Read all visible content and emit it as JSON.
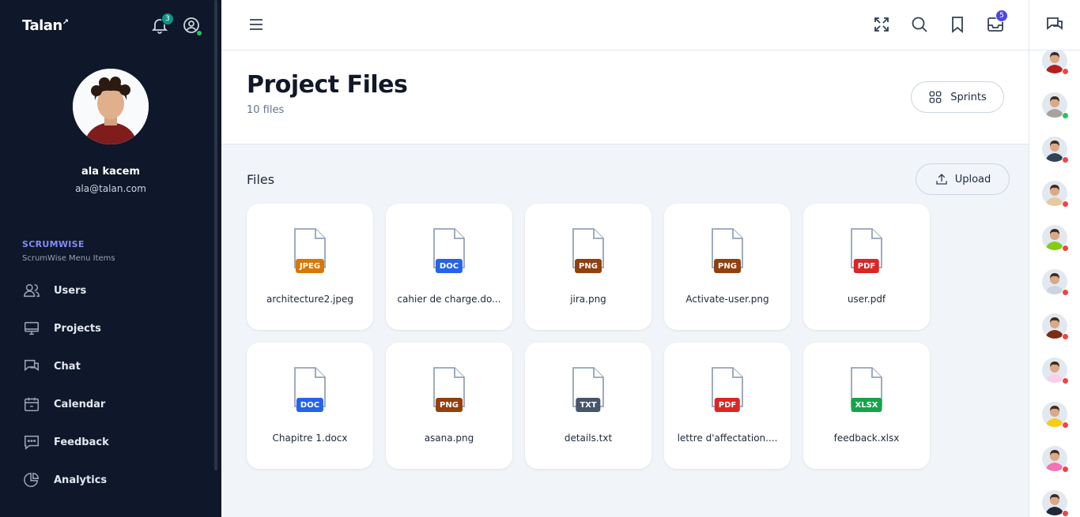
{
  "sidebar": {
    "logo": "Talan",
    "notification_count": "3",
    "user": {
      "name": "ala kacem",
      "email": "ala@talan.com"
    },
    "section_title": "SCRUMWISE",
    "section_subtitle": "ScrumWise Menu Items",
    "items": [
      {
        "label": "Users",
        "icon": "users-icon"
      },
      {
        "label": "Projects",
        "icon": "monitor-icon"
      },
      {
        "label": "Chat",
        "icon": "chat-icon"
      },
      {
        "label": "Calendar",
        "icon": "calendar-icon"
      },
      {
        "label": "Feedback",
        "icon": "feedback-icon"
      },
      {
        "label": "Analytics",
        "icon": "pie-chart-icon"
      }
    ]
  },
  "topbar": {
    "icons": [
      "fullscreen-icon",
      "search-icon",
      "bookmark-icon",
      "inbox-icon"
    ],
    "inbox_count": "5"
  },
  "header": {
    "title": "Project Files",
    "subtitle": "10 files",
    "sprints_label": "Sprints"
  },
  "files_section": {
    "title": "Files",
    "upload_label": "Upload",
    "files": [
      {
        "name": "architecture2.jpeg",
        "type": "JPEG",
        "color": "#d97706"
      },
      {
        "name": "cahier de charge.do...",
        "type": "DOC",
        "color": "#2563eb"
      },
      {
        "name": "jira.png",
        "type": "PNG",
        "color": "#92400e"
      },
      {
        "name": "Activate-user.png",
        "type": "PNG",
        "color": "#92400e"
      },
      {
        "name": "user.pdf",
        "type": "PDF",
        "color": "#dc2626"
      },
      {
        "name": "Chapitre 1.docx",
        "type": "DOC",
        "color": "#2563eb"
      },
      {
        "name": "asana.png",
        "type": "PNG",
        "color": "#92400e"
      },
      {
        "name": "details.txt",
        "type": "TXT",
        "color": "#475569"
      },
      {
        "name": "lettre d'affectation....",
        "type": "PDF",
        "color": "#dc2626"
      },
      {
        "name": "feedback.xlsx",
        "type": "XLSX",
        "color": "#16a34a"
      }
    ]
  },
  "contacts": [
    {
      "status": "#ef4444",
      "color": "#b91c1c"
    },
    {
      "status": "#22c55e",
      "color": "#a8a29e"
    },
    {
      "status": "#ef4444",
      "color": "#334155"
    },
    {
      "status": "#ef4444",
      "color": "#e7c9a0"
    },
    {
      "status": "#ef4444",
      "color": "#84cc16"
    },
    {
      "status": "#ef4444",
      "color": "#cbd5e1"
    },
    {
      "status": "#ef4444",
      "color": "#7c2d12"
    },
    {
      "status": "#ef4444",
      "color": "#fbcfe8"
    },
    {
      "status": "#ef4444",
      "color": "#facc15"
    },
    {
      "status": "#ef4444",
      "color": "#f472b6"
    },
    {
      "status": "#ef4444",
      "color": "#1f2937"
    }
  ]
}
